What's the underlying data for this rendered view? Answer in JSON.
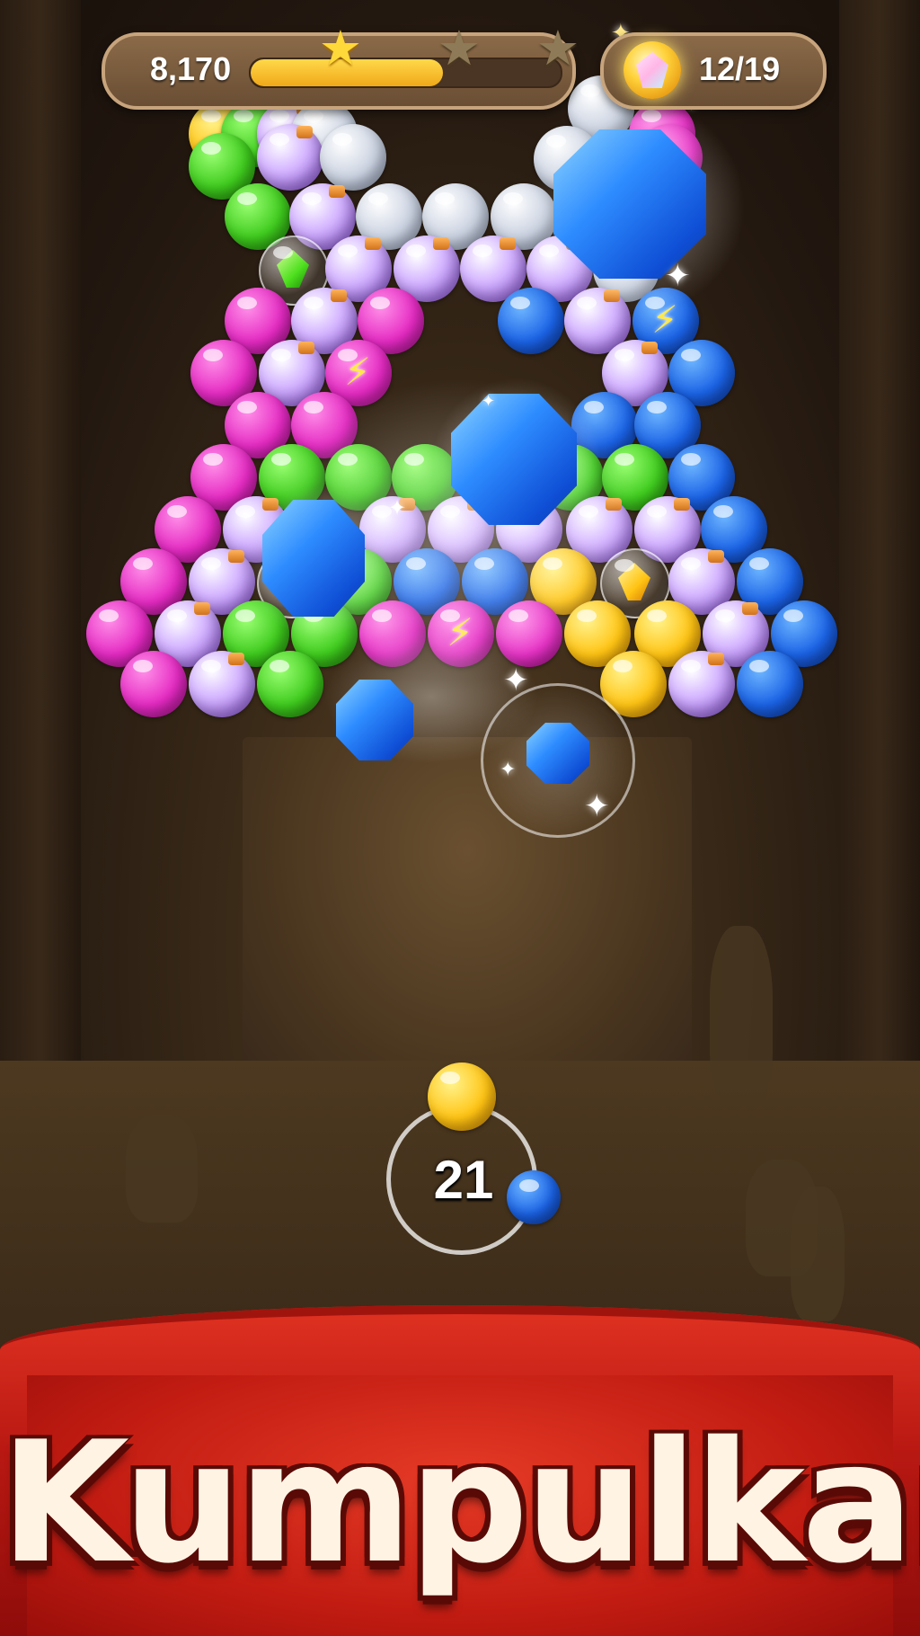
{
  "hud": {
    "score": "8,170",
    "progress": 0.62,
    "stars": [
      {
        "name": "star-1",
        "earned": true
      },
      {
        "name": "star-2",
        "earned": false
      },
      {
        "name": "star-3",
        "earned": false
      }
    ],
    "goal": "12/19",
    "goal_icon": "gem-collection-icon"
  },
  "shooter": {
    "shots_left": "21",
    "current_ball_color": "yellow",
    "next_ball_color": "blue"
  },
  "banner": {
    "text": "Kumpulkan"
  },
  "colors": {
    "banner_red": "#c21c12",
    "banner_text": "#fff4e4",
    "progress_fill": "#ffc414",
    "gem_blue": "#1b63e6"
  }
}
